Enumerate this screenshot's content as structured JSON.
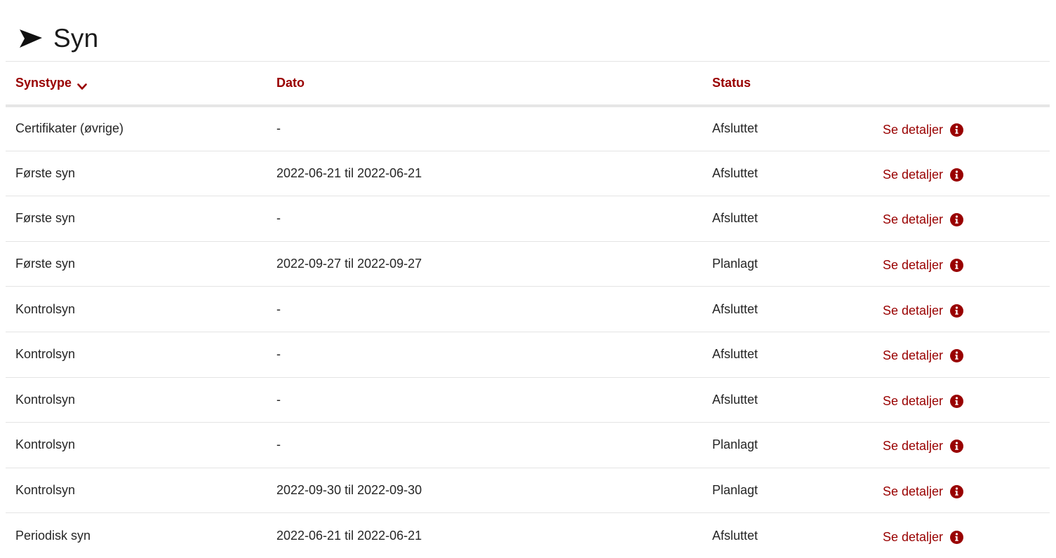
{
  "heading": {
    "icon": "arrow-right-icon",
    "title": "Syn"
  },
  "table": {
    "columns": [
      "Synstype",
      "Dato",
      "Status",
      ""
    ],
    "sort_icon": "chevron-down-icon",
    "link_label": "Se detaljer",
    "link_icon": "info-circle-icon",
    "rows": [
      {
        "synstype": "Certifikater (øvrige)",
        "dato": "-",
        "status": "Afsluttet",
        "link": "Se detaljer"
      },
      {
        "synstype": "Første syn",
        "dato": "2022-06-21 til 2022-06-21",
        "status": "Afsluttet",
        "link": "Se detaljer"
      },
      {
        "synstype": "Første syn",
        "dato": "-",
        "status": "Afsluttet",
        "link": "Se detaljer"
      },
      {
        "synstype": "Første syn",
        "dato": "2022-09-27 til 2022-09-27",
        "status": "Planlagt",
        "link": "Se detaljer"
      },
      {
        "synstype": "Kontrolsyn",
        "dato": "-",
        "status": "Afsluttet",
        "link": "Se detaljer"
      },
      {
        "synstype": "Kontrolsyn",
        "dato": "-",
        "status": "Afsluttet",
        "link": "Se detaljer"
      },
      {
        "synstype": "Kontrolsyn",
        "dato": "-",
        "status": "Afsluttet",
        "link": "Se detaljer"
      },
      {
        "synstype": "Kontrolsyn",
        "dato": "-",
        "status": "Planlagt",
        "link": "Se detaljer"
      },
      {
        "synstype": "Kontrolsyn",
        "dato": "2022-09-30 til 2022-09-30",
        "status": "Planlagt",
        "link": "Se detaljer"
      },
      {
        "synstype": "Periodisk syn",
        "dato": "2022-06-21 til 2022-06-21",
        "status": "Afsluttet",
        "link": "Se detaljer"
      }
    ]
  },
  "colors": {
    "accent": "#990000",
    "text": "#262626",
    "divider": "#e4e4e4"
  }
}
